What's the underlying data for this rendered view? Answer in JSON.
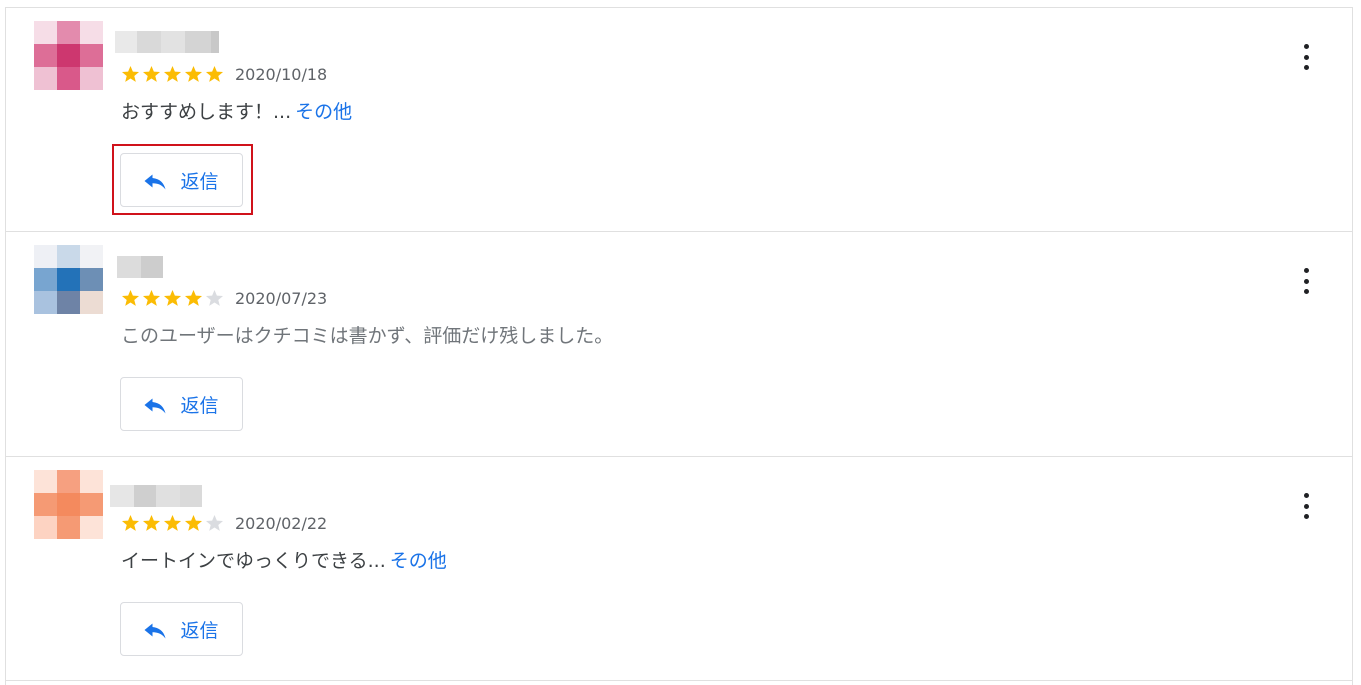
{
  "labels": {
    "reply": "返信",
    "more": "その他"
  },
  "colors": {
    "star_filled": "#fbbc04",
    "star_empty": "#dadce0",
    "link": "#1a73e8",
    "highlight": "#d0121b"
  },
  "reviews": [
    {
      "date": "2020/10/18",
      "rating": 5,
      "text": "おすすめします！...",
      "has_more": true,
      "avatar_colors": [
        "#f6dde7",
        "#e38bad",
        "#f6dde7",
        "#dd6e97",
        "#cd376f",
        "#dd6e97",
        "#efc1d3",
        "#d9598a",
        "#efc1d3"
      ]
    },
    {
      "date": "2020/07/23",
      "rating": 4,
      "text": "このユーザーはクチコミは書かず、評価だけ残しました。",
      "has_more": false,
      "avatar_colors": [
        "#eef0f5",
        "#c9d9e9",
        "#f1f2f5",
        "#78a5d0",
        "#2372b8",
        "#6d8fb5",
        "#a9c2df",
        "#6e83a6",
        "#ecdcd3"
      ]
    },
    {
      "date": "2020/02/22",
      "rating": 4,
      "text": "イートインでゆっくりできる...",
      "has_more": true,
      "avatar_colors": [
        "#fde3d8",
        "#f6a080",
        "#fde3d8",
        "#f59a74",
        "#f48a5e",
        "#f59a74",
        "#fdd3c2",
        "#f59a74",
        "#fde3d8"
      ]
    }
  ]
}
